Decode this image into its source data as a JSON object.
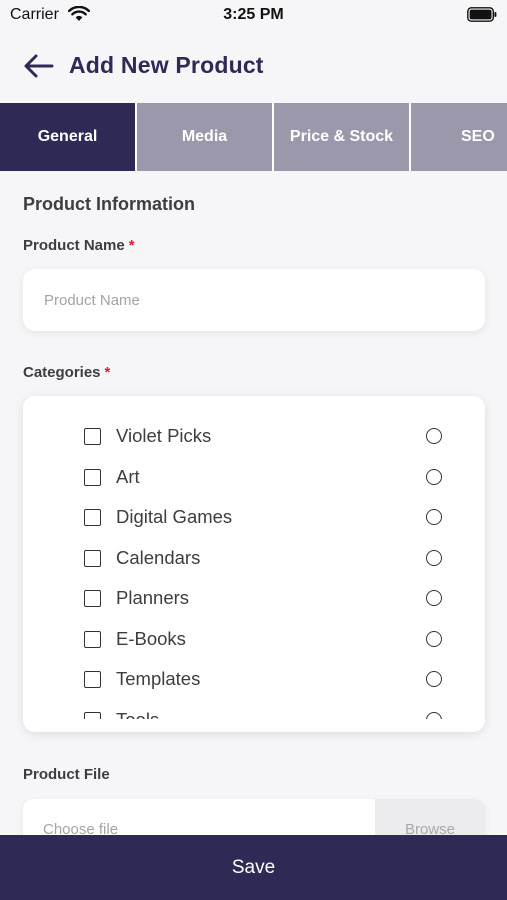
{
  "status_bar": {
    "carrier": "Carrier",
    "time": "3:25 PM"
  },
  "header": {
    "title": "Add New Product",
    "back_icon": "arrow-left-icon"
  },
  "tabs": [
    {
      "label": "General",
      "active": true
    },
    {
      "label": "Media",
      "active": false
    },
    {
      "label": "Price & Stock",
      "active": false
    },
    {
      "label": "SEO",
      "active": false
    }
  ],
  "form": {
    "section_title": "Product Information",
    "product_name": {
      "label": "Product Name",
      "required_mark": "*",
      "placeholder": "Product Name",
      "value": ""
    },
    "categories": {
      "label": "Categories",
      "required_mark": "*",
      "items": [
        {
          "label": "Violet Picks",
          "checked": false,
          "primary": false
        },
        {
          "label": "Art",
          "checked": false,
          "primary": false
        },
        {
          "label": "Digital Games",
          "checked": false,
          "primary": false
        },
        {
          "label": "Calendars",
          "checked": false,
          "primary": false
        },
        {
          "label": "Planners",
          "checked": false,
          "primary": false
        },
        {
          "label": "E-Books",
          "checked": false,
          "primary": false
        },
        {
          "label": "Templates",
          "checked": false,
          "primary": false
        },
        {
          "label": "Tools",
          "checked": false,
          "primary": false
        }
      ]
    },
    "product_file": {
      "label": "Product File",
      "file_name": "Choose file",
      "browse_label": "Browse"
    }
  },
  "save_label": "Save",
  "colors": {
    "primary": "#2e2a55",
    "tab_inactive": "#9c98ab",
    "required": "#d81e2c",
    "background": "#f6f6f8"
  }
}
